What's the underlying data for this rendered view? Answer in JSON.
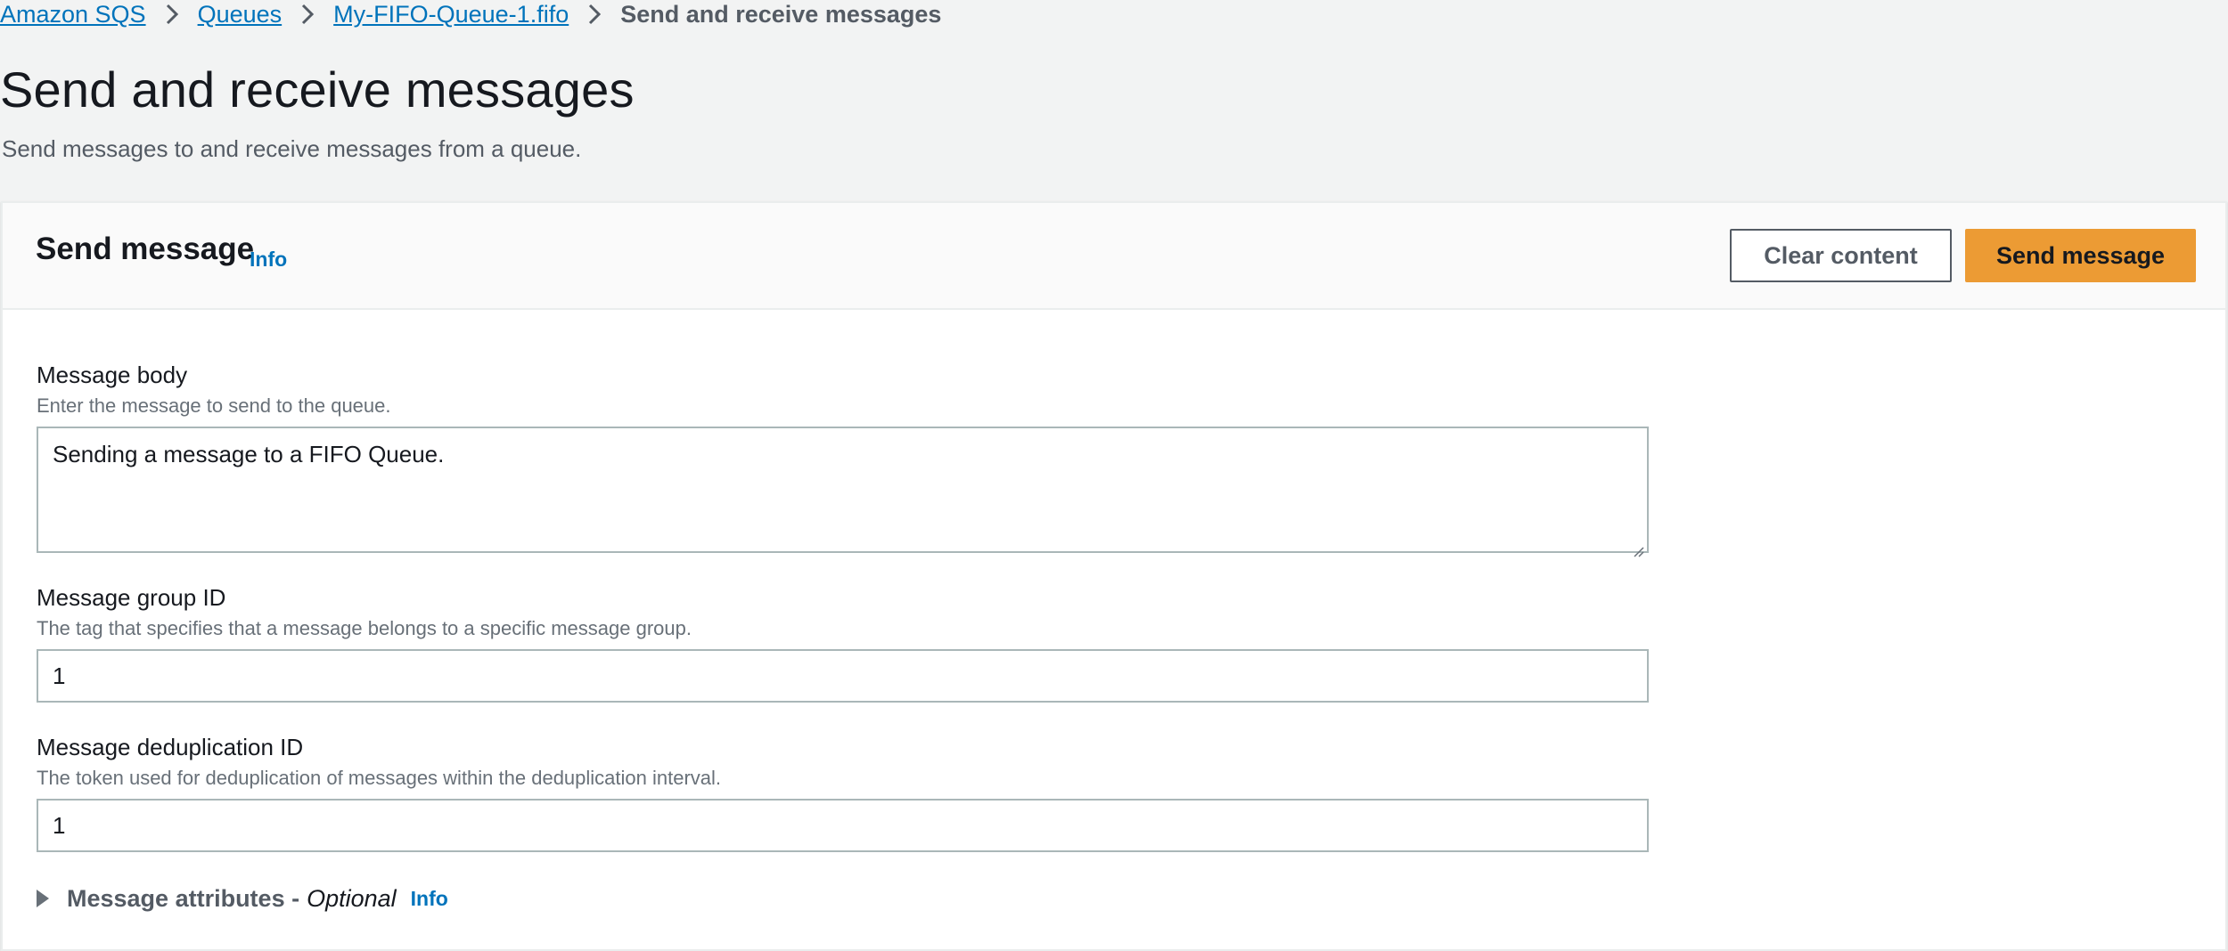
{
  "breadcrumb": {
    "items": [
      "Amazon SQS",
      "Queues",
      "My-FIFO-Queue-1.fifo"
    ],
    "current": "Send and receive messages"
  },
  "page": {
    "title": "Send and receive messages",
    "subtitle": "Send messages to and receive messages from a queue."
  },
  "send_panel": {
    "title": "Send message",
    "info_label": "Info",
    "clear_button": "Clear content",
    "send_button": "Send message"
  },
  "fields": {
    "body": {
      "label": "Message body",
      "description": "Enter the message to send to the queue.",
      "value": "Sending a message to a FIFO Queue."
    },
    "group_id": {
      "label": "Message group ID",
      "description": "The tag that specifies that a message belongs to a specific message group.",
      "value": "1"
    },
    "dedup_id": {
      "label": "Message deduplication ID",
      "description": "The token used for deduplication of messages within the deduplication interval.",
      "value": "1"
    }
  },
  "attributes": {
    "label": "Message attributes -",
    "optional": "Optional",
    "info_label": "Info"
  },
  "colors": {
    "link": "#0073bb",
    "primary_button": "#ec9b34",
    "page_background": "#f2f3f3"
  },
  "icons": {
    "breadcrumb_separator": "chevron-right-icon",
    "expander": "caret-right-icon",
    "resize": "resize-grip-icon"
  }
}
